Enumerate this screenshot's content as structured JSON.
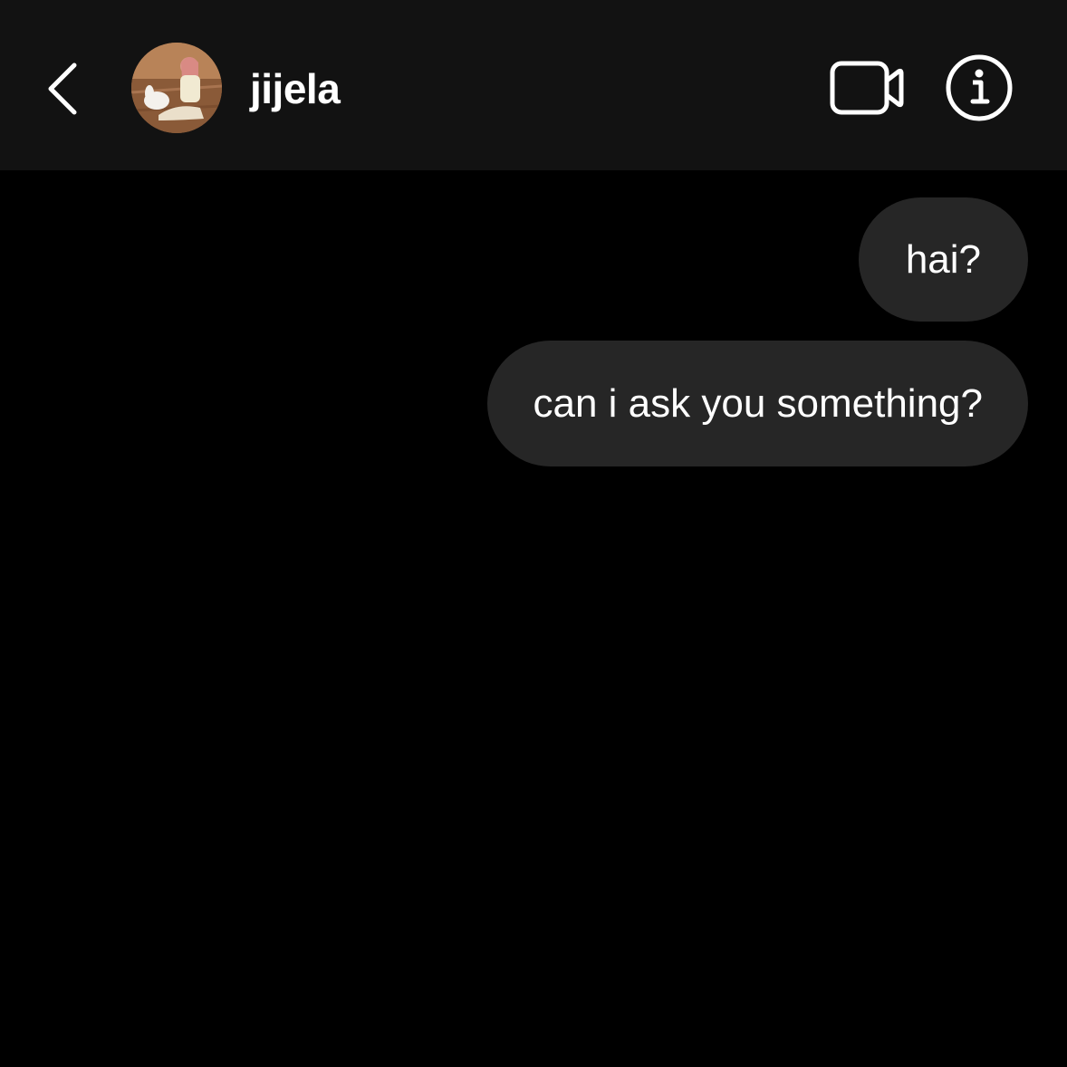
{
  "header": {
    "username": "jijela",
    "back_icon": "chevron-left-icon",
    "video_icon": "video-camera-icon",
    "info_icon": "info-icon"
  },
  "messages": [
    {
      "text": "hai?",
      "sender": "me"
    },
    {
      "text": "can i ask you something?",
      "sender": "me"
    }
  ],
  "colors": {
    "background": "#000000",
    "header": "#121212",
    "bubble": "#262626",
    "text": "#ffffff"
  }
}
